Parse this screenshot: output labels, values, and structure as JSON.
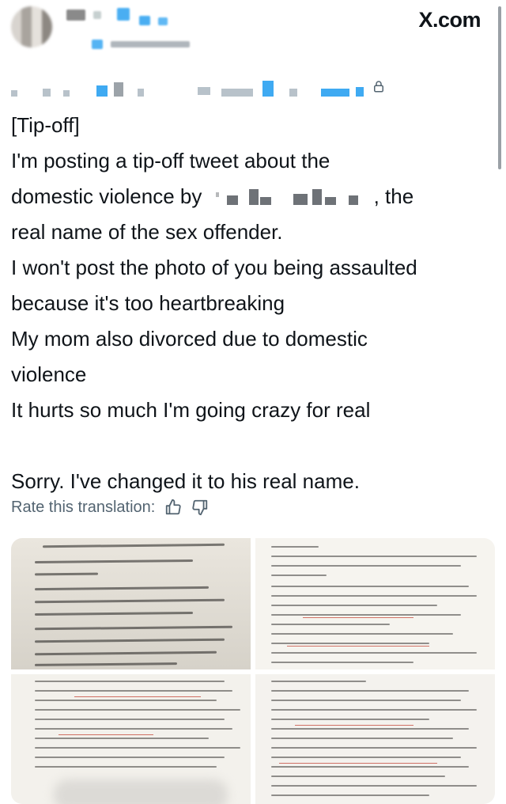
{
  "brand": {
    "label": "X.com"
  },
  "tweet": {
    "lines": [
      "[Tip-off]",
      "I'm posting a tip-off tweet about the",
      "domestic violence by",
      ", the",
      "real name of the sex offender.",
      "I won't post the photo of you being assaulted",
      "because it's too heartbreaking",
      "My mom also divorced due to domestic",
      "violence",
      "It hurts so much I'm going crazy for real",
      "Sorry. I've changed it to his real name."
    ]
  },
  "translation": {
    "label": "Rate this translation:"
  },
  "icons": {
    "lock": "lock-icon",
    "thumbs_up": "thumbs-up-icon",
    "thumbs_down": "thumbs-down-icon"
  },
  "colors": {
    "accent": "#1d9bf0",
    "muted": "#536471",
    "text": "#0f1419"
  }
}
